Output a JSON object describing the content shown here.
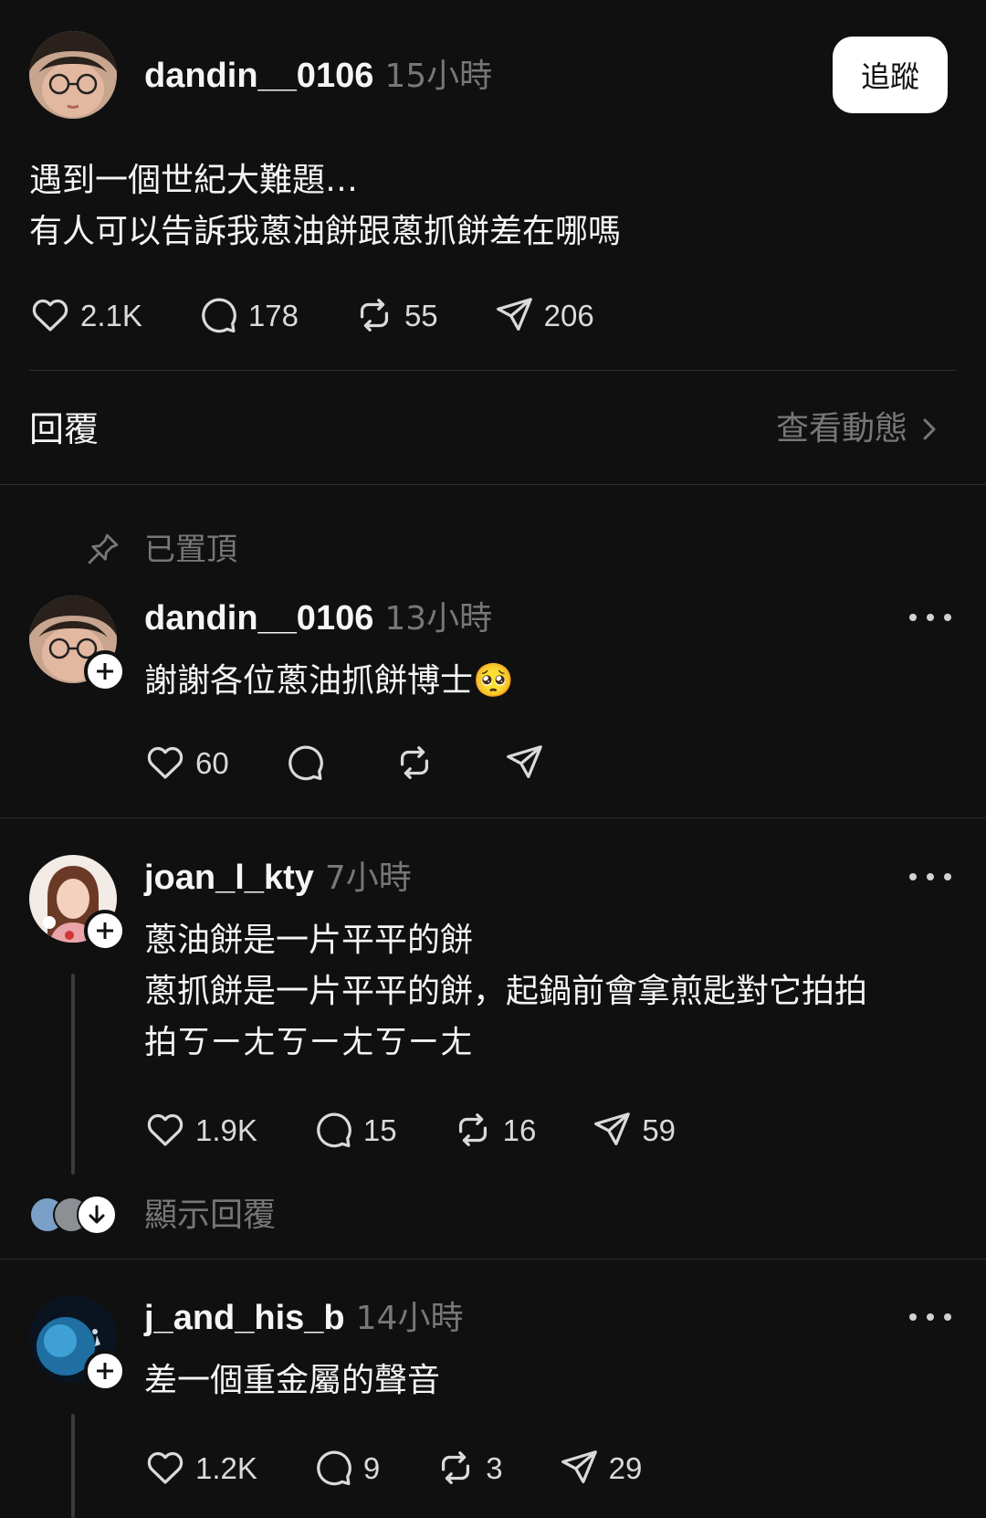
{
  "original_post": {
    "username": "dandin__0106",
    "time": "15小時",
    "follow_label": "追蹤",
    "text": "遇到一個世紀大難題…\n有人可以告訴我蔥油餅跟蔥抓餅差在哪嗎",
    "likes": "2.1K",
    "comments": "178",
    "reposts": "55",
    "shares": "206"
  },
  "replies_header": {
    "title": "回覆",
    "view_activity": "查看動態"
  },
  "pinned": {
    "label": "已置頂",
    "username": "dandin__0106",
    "time": "13小時",
    "text": "謝謝各位蔥油抓餅博士",
    "emoji": "🥺",
    "likes": "60"
  },
  "reply_1": {
    "username": "joan_l_kty",
    "time": "7小時",
    "text": "蔥油餅是一片平平的餅\n蔥抓餅是一片平平的餅，起鍋前會拿煎匙對它拍拍\n拍ㄎㄧㄤㄎㄧㄤㄎㄧㄤ",
    "likes": "1.9K",
    "comments": "15",
    "reposts": "16",
    "shares": "59",
    "show_replies": "顯示回覆"
  },
  "reply_2": {
    "username": "j_and_his_b",
    "time": "14小時",
    "text": "差一個重金屬的聲音",
    "likes": "1.2K",
    "comments": "9",
    "reposts": "3",
    "shares": "29"
  },
  "icons": {
    "like": "heart-icon",
    "comment": "comment-icon",
    "repost": "repost-icon",
    "share": "send-icon",
    "pin": "pin-icon",
    "chevron": "chevron-right-icon",
    "more": "more-icon"
  },
  "colors": {
    "background": "#101010",
    "text": "#f3f5f7",
    "secondary": "#777777",
    "button_bg": "#ffffff"
  }
}
